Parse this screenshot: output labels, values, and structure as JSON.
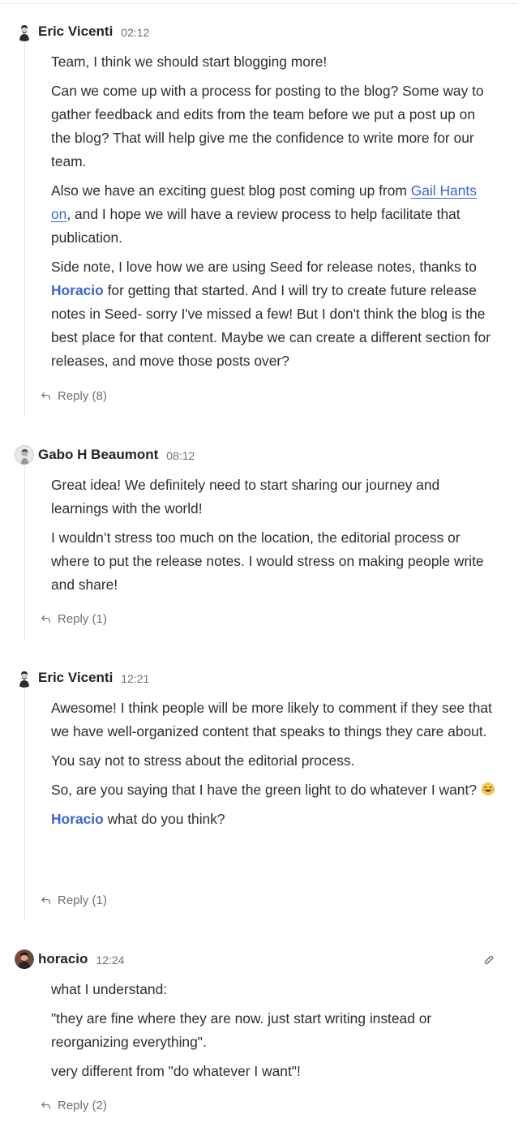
{
  "comments": [
    {
      "author": "Eric Vicenti",
      "time": "02:12",
      "paragraphs": {
        "p1": "Team, I think we should start blogging more!",
        "p2": "Can we come up with a process for posting to the blog? Some way to gather feedback and edits from the team before we put a post up on the blog? That will help give me the confidence to write more for our team.",
        "p3_before": "Also we have an exciting guest blog post coming up from ",
        "p3_link": "Gail Hants on",
        "p3_after": ", and I hope we will have a review process to help facilitate that publication.",
        "p4_before": "Side note, I love how we are using Seed for release notes, thanks to ",
        "p4_mention": "Horacio",
        "p4_after": " for getting that started. And I will try to create future release notes in Seed- sorry I've missed a few! But I don't think the blog is the best place for that content. Maybe we can create a different section for releases, and move those posts over?"
      },
      "reply_label": "Reply (8)"
    },
    {
      "author": "Gabo H Beaumont",
      "time": "08:12",
      "paragraphs": {
        "p1": "Great idea! We definitely need to start sharing our journey and learnings with the world!",
        "p2": "I wouldn’t stress too much on the location, the editorial process or where to put the release notes. I would stress on making people write and share!"
      },
      "reply_label": "Reply (1)"
    },
    {
      "author": "Eric Vicenti",
      "time": "12:21",
      "paragraphs": {
        "p1": "Awesome! I think people will be more likely to comment if they see that we have well-organized content that speaks to things they care about.",
        "p2": "You say not to stress about the editorial process.",
        "p3": "So, are you saying that I have the green light to do whatever I want? ",
        "p4_mention": "Horacio",
        "p4_after": " what do you think?"
      },
      "reply_label": "Reply (1)"
    },
    {
      "author": "horacio",
      "time": "12:24",
      "paragraphs": {
        "p1": "what I understand:",
        "p2": "\"they are fine where they are now. just start writing instead or reorganizing everything\".",
        "p3": "very different from \"do whatever I want\"!"
      },
      "reply_label": "Reply (2)"
    }
  ],
  "icons": {
    "reply": "reply-arrow-icon",
    "link": "link-icon",
    "emoji": "laughing-tears-emoji"
  },
  "colors": {
    "mention": "#3a66d6",
    "muted": "#6b7078",
    "text": "#2a2e33"
  }
}
